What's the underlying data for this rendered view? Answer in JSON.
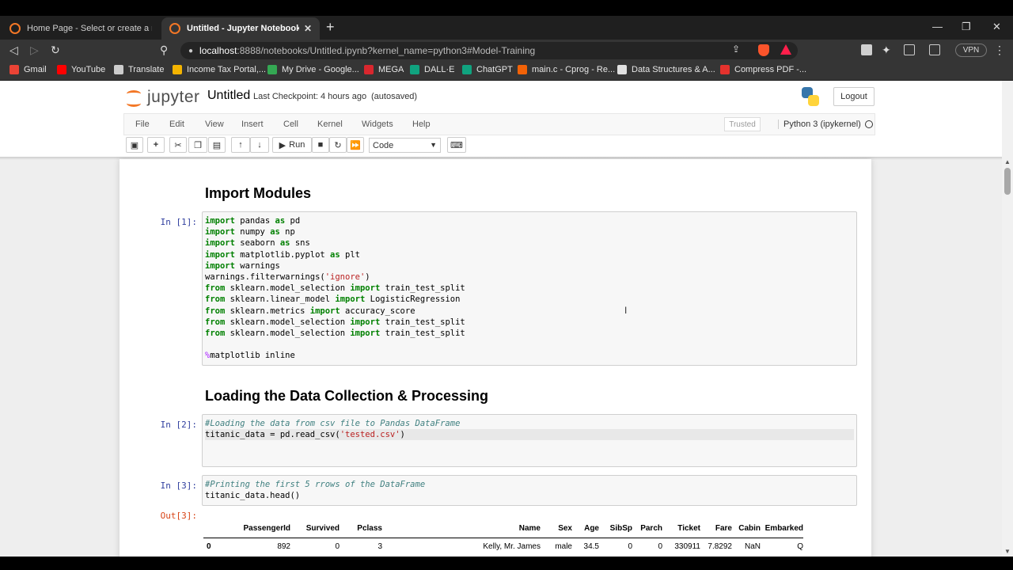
{
  "browser": {
    "tabs": [
      {
        "title": "Home Page - Select or create a notebo",
        "active": false
      },
      {
        "title": "Untitled - Jupyter Notebook",
        "active": true
      }
    ],
    "url_host": "localhost",
    "url_rest": ":8888/notebooks/Untitled.ipynb?kernel_name=python3#Model-Training",
    "vpn_label": "VPN",
    "bookmarks": [
      {
        "label": "Gmail",
        "color": "#ea4335"
      },
      {
        "label": "YouTube",
        "color": "#ff0000"
      },
      {
        "label": "Translate",
        "color": "#cccccc"
      },
      {
        "label": "Income Tax Portal,...",
        "color": "#f4b400"
      },
      {
        "label": "My Drive - Google...",
        "color": "#34a853"
      },
      {
        "label": "MEGA",
        "color": "#d9272e"
      },
      {
        "label": "DALL·E",
        "color": "#10a37f"
      },
      {
        "label": "ChatGPT",
        "color": "#10a37f"
      },
      {
        "label": "main.c - Cprog - Re...",
        "color": "#f26207"
      },
      {
        "label": "Data Structures & A...",
        "color": "#e0e0e0"
      },
      {
        "label": "Compress PDF -...",
        "color": "#e5322d"
      }
    ]
  },
  "jupyter": {
    "logo_text": "jupyter",
    "notebook_name": "Untitled",
    "checkpoint": "Last Checkpoint: 4 hours ago",
    "autosave": "(autosaved)",
    "logout": "Logout",
    "menu": [
      "File",
      "Edit",
      "View",
      "Insert",
      "Cell",
      "Kernel",
      "Widgets",
      "Help"
    ],
    "trusted": "Trusted",
    "kernel": "Python 3 (ipykernel)",
    "run_label": "Run",
    "cell_type": "Code"
  },
  "notebook": {
    "heading1": "Import Modules",
    "heading2": "Loading the Data Collection & Processing",
    "cell1_prompt": "In [1]:",
    "cell2_prompt": "In [2]:",
    "cell3_prompt": "In [3]:",
    "out3_prompt": "Out[3]:",
    "cell1_lines": [
      [
        [
          "kw",
          "import"
        ],
        [
          "t",
          " pandas "
        ],
        [
          "kw",
          "as"
        ],
        [
          "t",
          " pd"
        ]
      ],
      [
        [
          "kw",
          "import"
        ],
        [
          "t",
          " numpy "
        ],
        [
          "kw",
          "as"
        ],
        [
          "t",
          " np"
        ]
      ],
      [
        [
          "kw",
          "import"
        ],
        [
          "t",
          " seaborn "
        ],
        [
          "kw",
          "as"
        ],
        [
          "t",
          " sns"
        ]
      ],
      [
        [
          "kw",
          "import"
        ],
        [
          "t",
          " matplotlib.pyplot "
        ],
        [
          "kw",
          "as"
        ],
        [
          "t",
          " plt"
        ]
      ],
      [
        [
          "kw",
          "import"
        ],
        [
          "t",
          " warnings"
        ]
      ],
      [
        [
          "t",
          "warnings.filterwarnings("
        ],
        [
          "str",
          "'ignore'"
        ],
        [
          "t",
          ")"
        ]
      ],
      [
        [
          "kw",
          "from"
        ],
        [
          "t",
          " sklearn.model_selection "
        ],
        [
          "kw",
          "import"
        ],
        [
          "t",
          " train_test_split"
        ]
      ],
      [
        [
          "kw",
          "from"
        ],
        [
          "t",
          " sklearn.linear_model "
        ],
        [
          "kw",
          "import"
        ],
        [
          "t",
          " LogisticRegression"
        ]
      ],
      [
        [
          "kw",
          "from"
        ],
        [
          "t",
          " sklearn.metrics "
        ],
        [
          "kw",
          "import"
        ],
        [
          "t",
          " accuracy_score"
        ]
      ],
      [
        [
          "kw",
          "from"
        ],
        [
          "t",
          " sklearn.model_selection "
        ],
        [
          "kw",
          "import"
        ],
        [
          "t",
          " train_test_split"
        ]
      ],
      [
        [
          "kw",
          "from"
        ],
        [
          "t",
          " sklearn.model_selection "
        ],
        [
          "kw",
          "import"
        ],
        [
          "t",
          " train_test_split"
        ]
      ],
      [
        [
          "t",
          ""
        ]
      ],
      [
        [
          "mag",
          "%"
        ],
        [
          "t",
          "matplotlib inline"
        ]
      ]
    ],
    "cell2_lines": [
      [
        [
          "cmt",
          "#Loading the data from csv file to Pandas DataFrame"
        ]
      ],
      [
        [
          "t",
          "titanic_data = pd.read_csv("
        ],
        [
          "str",
          "'tested.csv'"
        ],
        [
          "t",
          ")"
        ]
      ]
    ],
    "cell3_lines": [
      [
        [
          "cmt",
          "#Printing the first 5 rrows of the DataFrame"
        ]
      ],
      [
        [
          "t",
          "titanic_data.head()"
        ]
      ]
    ],
    "table": {
      "columns": [
        "",
        "PassengerId",
        "Survived",
        "Pclass",
        "Name",
        "Sex",
        "Age",
        "SibSp",
        "Parch",
        "Ticket",
        "Fare",
        "Cabin",
        "Embarked"
      ],
      "rows": [
        [
          "0",
          "892",
          "0",
          "3",
          "Kelly, Mr. James",
          "male",
          "34.5",
          "0",
          "0",
          "330911",
          "7.8292",
          "NaN",
          "Q"
        ]
      ]
    }
  }
}
